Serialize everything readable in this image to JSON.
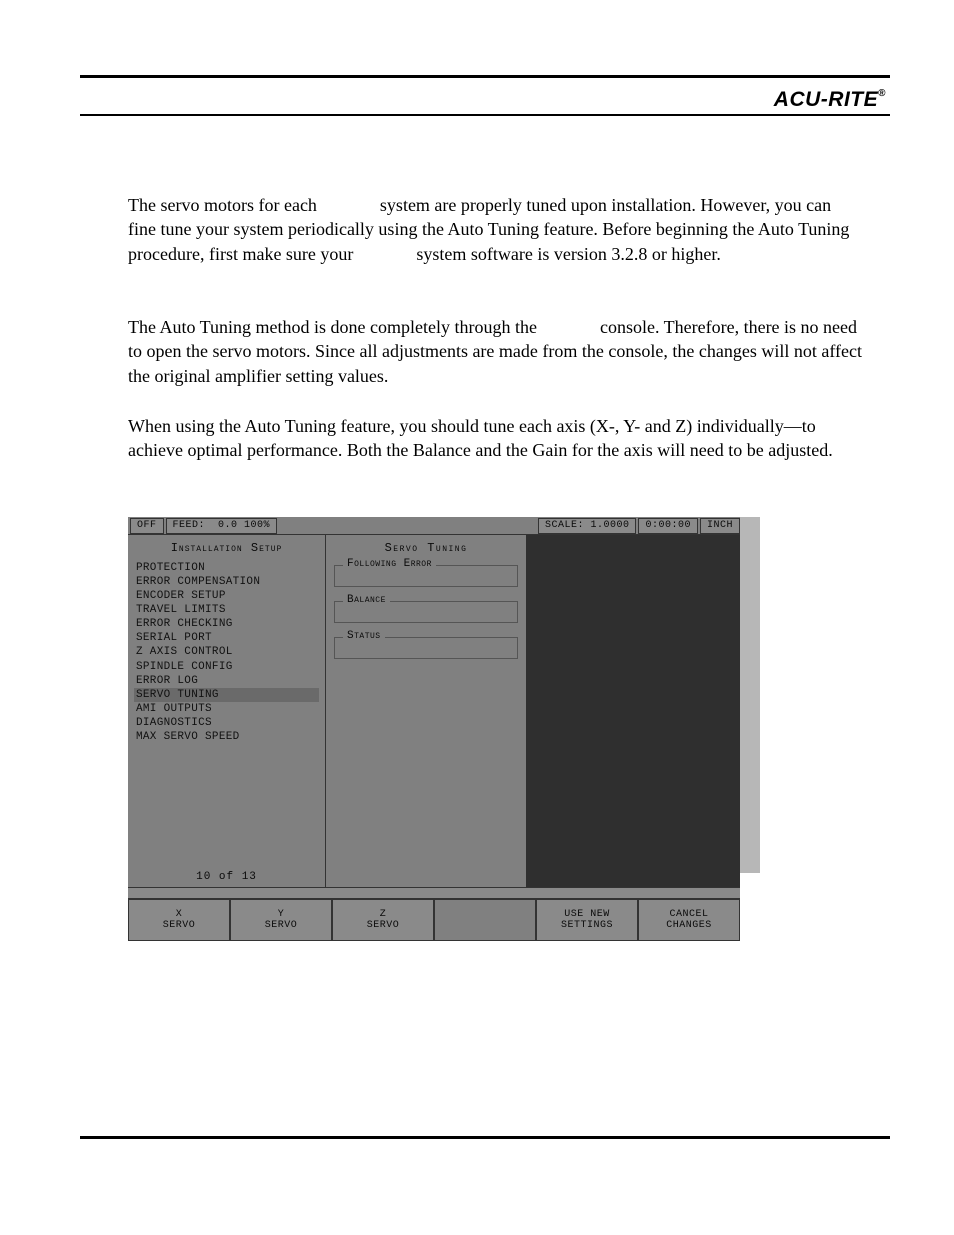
{
  "brand": "ACU-RITE",
  "brand_mark": "®",
  "paragraphs": {
    "p1": "The servo motors for each              system are properly tuned upon installation. However, you can fine tune your system periodically using the Auto Tuning feature. Before beginning the Auto Tuning procedure, first make sure your              system software is version 3.2.8 or higher.",
    "p2": "The Auto Tuning method is done completely through the              console. Therefore, there is no need to open the servo motors. Since all adjustments are made from the console, the changes will not affect the original amplifier setting values.",
    "p3": "When using the Auto Tuning feature, you should tune each axis (X-, Y- and Z) individually—to achieve optimal performance. Both the Balance and the Gain for the axis will need to be adjusted."
  },
  "screenshot": {
    "topbar": {
      "off": "OFF",
      "feed_label": "FEED:",
      "feed_value": "0.0 100%",
      "scale": "SCALE: 1.0000",
      "time": "0:00:00",
      "units": "INCH"
    },
    "left": {
      "title": "Installation Setup",
      "items": [
        "Protection",
        "Error Compensation",
        "Encoder Setup",
        "Travel Limits",
        "Error Checking",
        "Serial Port",
        "Z Axis Control",
        "Spindle Config",
        "Error Log",
        "Servo Tuning",
        "AMI Outputs",
        "Diagnostics",
        "Max Servo Speed"
      ],
      "selected_index": 9,
      "page": "10 of 13"
    },
    "panel": {
      "title": "Servo Tuning",
      "groups": [
        "Following Error",
        "Balance",
        "Status"
      ]
    },
    "softkeys": [
      {
        "line1": "X",
        "line2": "Servo"
      },
      {
        "line1": "Y",
        "line2": "Servo"
      },
      {
        "line1": "Z",
        "line2": "Servo"
      },
      {
        "line1": "",
        "line2": ""
      },
      {
        "line1": "Use New",
        "line2": "Settings"
      },
      {
        "line1": "Cancel",
        "line2": "Changes"
      }
    ]
  }
}
